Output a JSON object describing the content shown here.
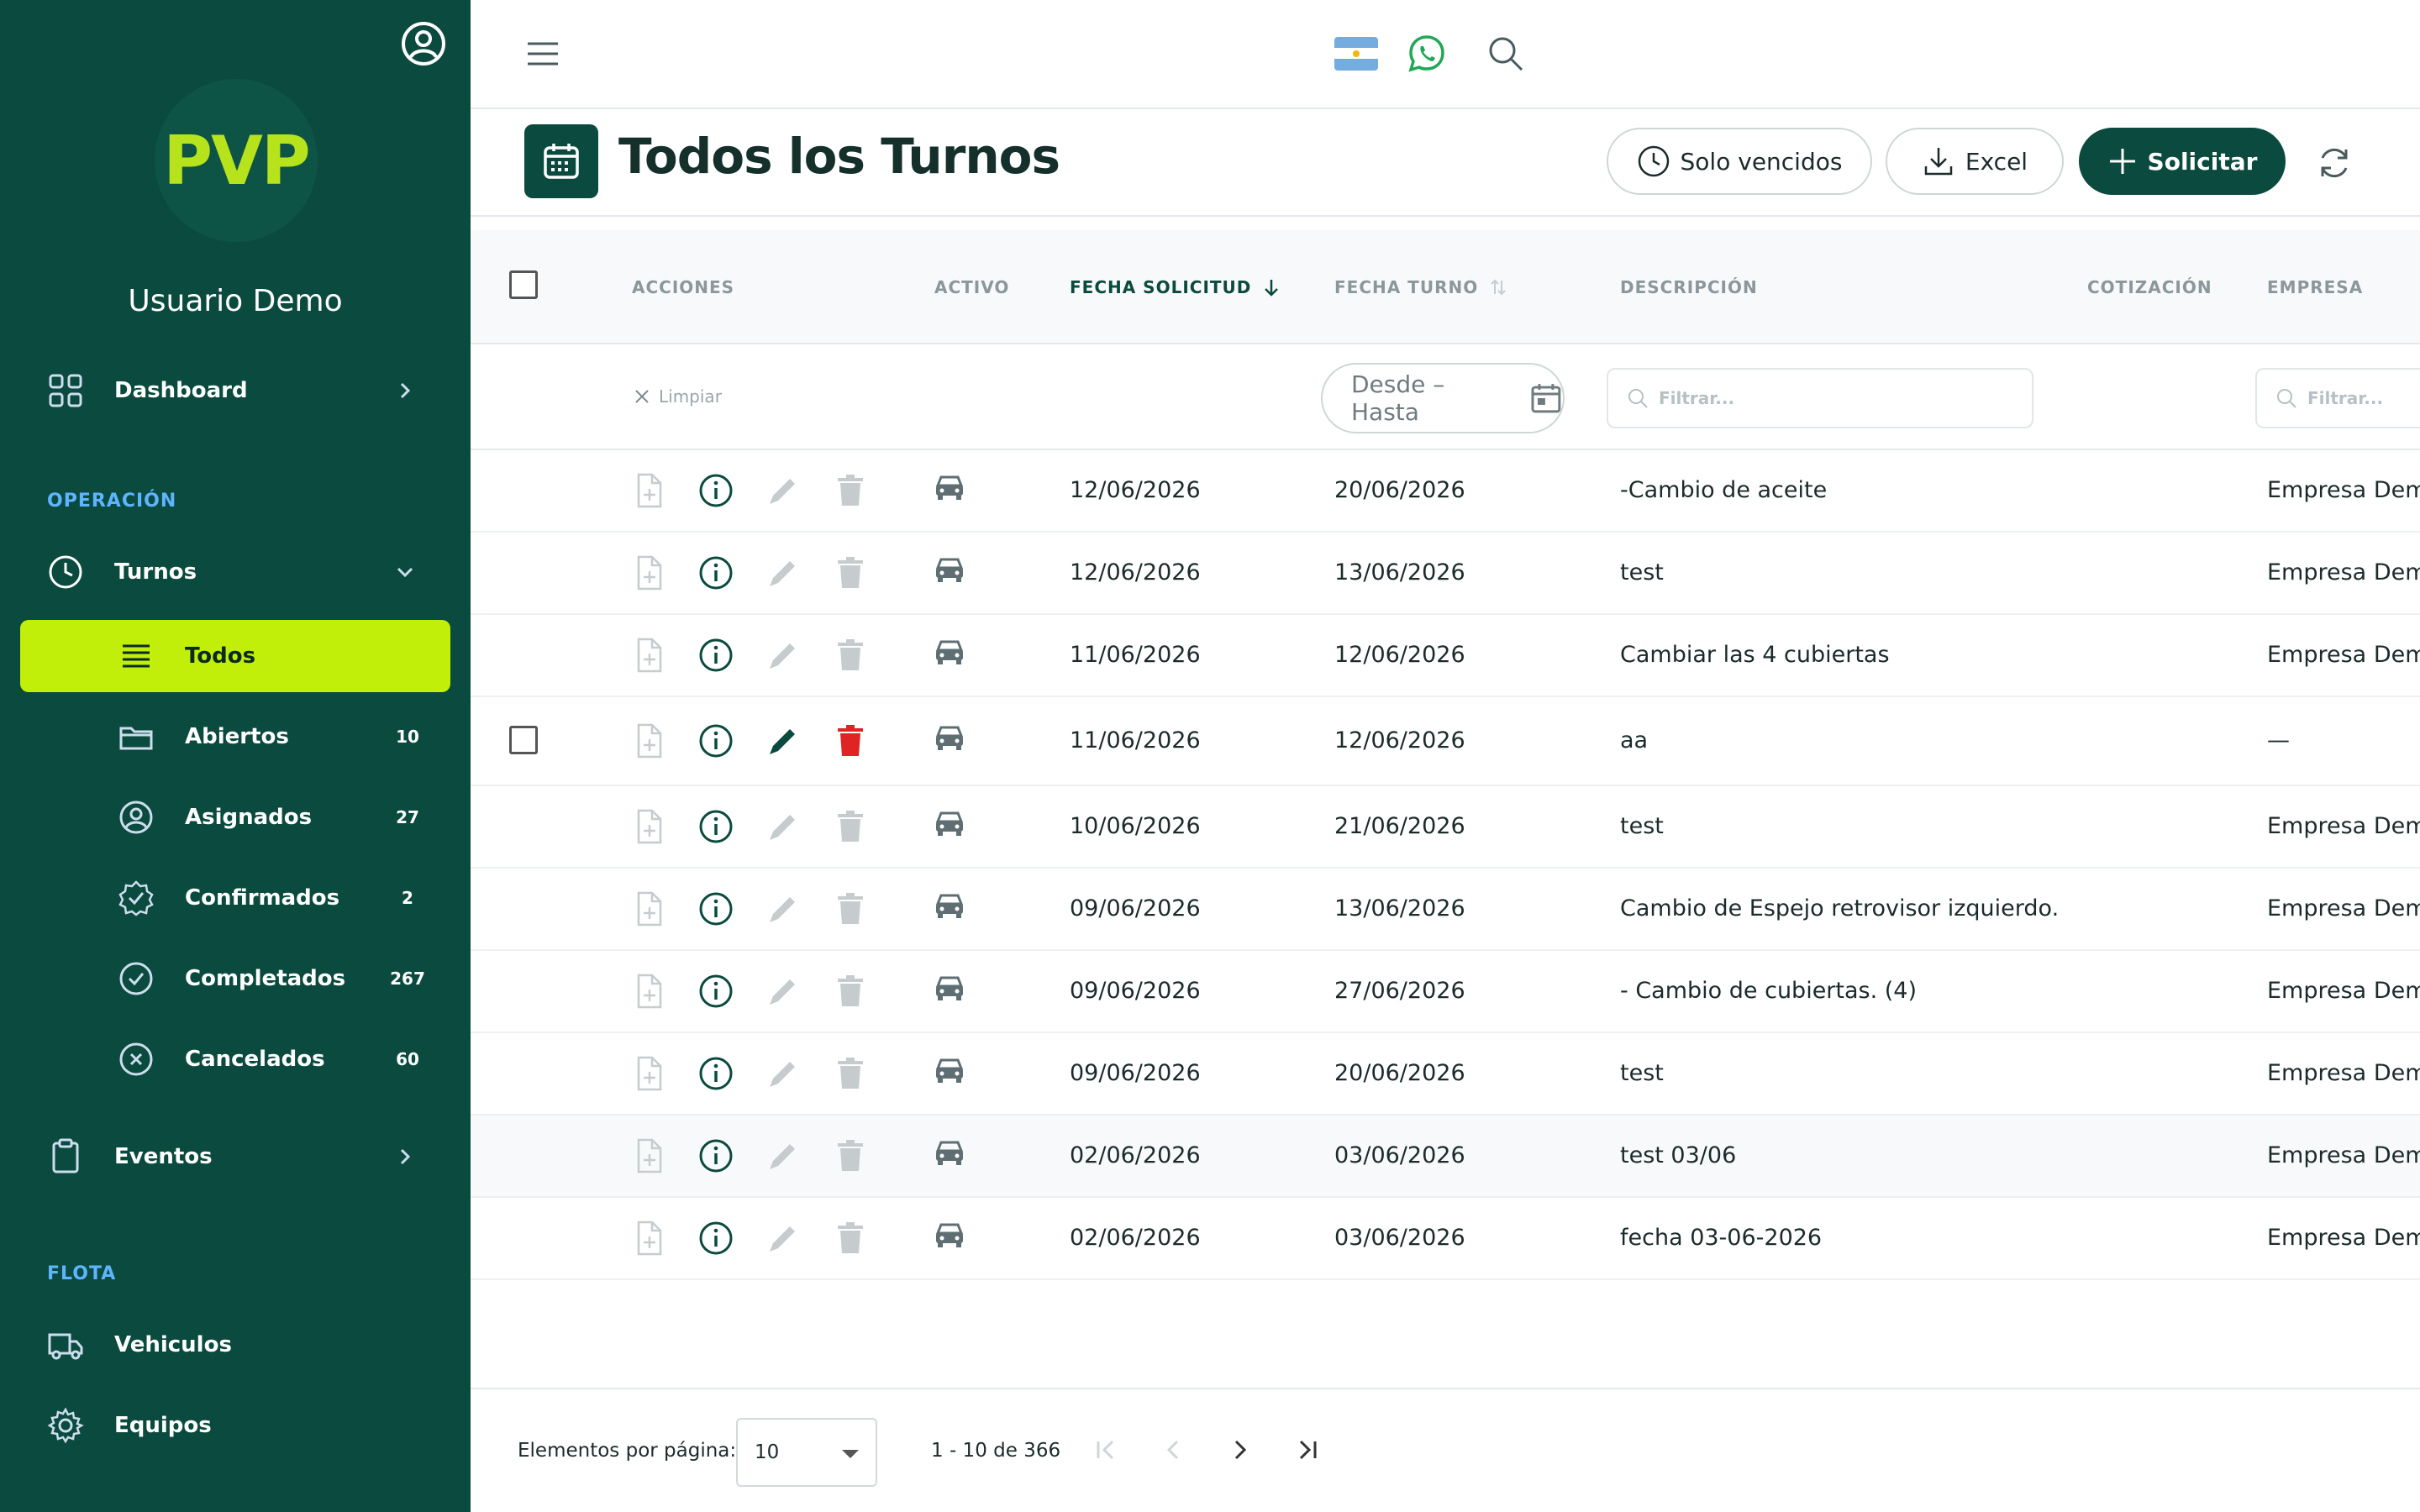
{
  "sidebar": {
    "logo_text": "PVP",
    "username": "Usuario Demo",
    "dashboard_label": "Dashboard",
    "section_operacion": "OPERACIÓN",
    "turnos_label": "Turnos",
    "sub_items": [
      {
        "label": "Todos",
        "count": ""
      },
      {
        "label": "Abiertos",
        "count": "10"
      },
      {
        "label": "Asignados",
        "count": "27"
      },
      {
        "label": "Confirmados",
        "count": "2"
      },
      {
        "label": "Completados",
        "count": "267"
      },
      {
        "label": "Cancelados",
        "count": "60"
      }
    ],
    "eventos_label": "Eventos",
    "section_flota": "FLOTA",
    "vehiculos_label": "Vehiculos",
    "equipos_label": "Equipos"
  },
  "header": {
    "title": "Todos los Turnos",
    "btn_vencidos": "Solo vencidos",
    "btn_excel": "Excel",
    "btn_solicitar": "Solicitar"
  },
  "table": {
    "columns": {
      "acciones": "ACCIONES",
      "activo": "ACTIVO",
      "fecha_solicitud": "FECHA SOLICITUD",
      "fecha_turno": "FECHA TURNO",
      "descripcion": "DESCRIPCIÓN",
      "cotizacion": "COTIZACIÓN",
      "empresa": "EMPRESA"
    },
    "filters": {
      "clear_label": "Limpiar",
      "date_range_placeholder": "Desde – Hasta",
      "desc_placeholder": "Filtrar...",
      "empresa_placeholder": "Filtrar..."
    },
    "rows": [
      {
        "fecha_solicitud": "12/06/2026",
        "fecha_turno": "20/06/2026",
        "descripcion": "-Cambio de aceite",
        "empresa": "Empresa Demo"
      },
      {
        "fecha_solicitud": "12/06/2026",
        "fecha_turno": "13/06/2026",
        "descripcion": "test",
        "empresa": "Empresa Demo"
      },
      {
        "fecha_solicitud": "11/06/2026",
        "fecha_turno": "12/06/2026",
        "descripcion": "Cambiar las 4 cubiertas",
        "empresa": "Empresa Demo"
      },
      {
        "fecha_solicitud": "11/06/2026",
        "fecha_turno": "12/06/2026",
        "descripcion": "aa",
        "empresa": "—"
      },
      {
        "fecha_solicitud": "10/06/2026",
        "fecha_turno": "21/06/2026",
        "descripcion": "test",
        "empresa": "Empresa Demo"
      },
      {
        "fecha_solicitud": "09/06/2026",
        "fecha_turno": "13/06/2026",
        "descripcion": "Cambio de Espejo retrovisor izquierdo.",
        "empresa": "Empresa Demo"
      },
      {
        "fecha_solicitud": "09/06/2026",
        "fecha_turno": "27/06/2026",
        "descripcion": "- Cambio de cubiertas. (4)",
        "empresa": "Empresa Demo"
      },
      {
        "fecha_solicitud": "09/06/2026",
        "fecha_turno": "20/06/2026",
        "descripcion": "test",
        "empresa": "Empresa Demo"
      },
      {
        "fecha_solicitud": "02/06/2026",
        "fecha_turno": "03/06/2026",
        "descripcion": "test 03/06",
        "empresa": "Empresa Demo"
      },
      {
        "fecha_solicitud": "02/06/2026",
        "fecha_turno": "03/06/2026",
        "descripcion": "fecha 03-06-2026",
        "empresa": "Empresa Demo"
      }
    ]
  },
  "paginator": {
    "label": "Elementos por página:",
    "page_size": "10",
    "range": "1 - 10 de 366"
  },
  "colors": {
    "sidebar_bg": "#0b4a3e",
    "accent_lime": "#c1ef0a",
    "logo_green": "#b6e31b",
    "section_blue": "#5fb4ff",
    "delete_red": "#e02424",
    "edit_green": "#0b4a3e"
  },
  "icons": {
    "user": "user-circle-icon",
    "menu": "hamburger-menu-icon",
    "flag": "argentina-flag-icon",
    "whatsapp": "whatsapp-icon",
    "search": "search-icon",
    "calendar": "calendar-icon",
    "clock": "clock-icon",
    "download": "download-icon",
    "plus": "plus-icon",
    "refresh": "refresh-icon",
    "file_add": "file-add-icon",
    "info": "info-icon",
    "pencil": "pencil-icon",
    "trash": "trash-icon",
    "car": "car-icon"
  }
}
